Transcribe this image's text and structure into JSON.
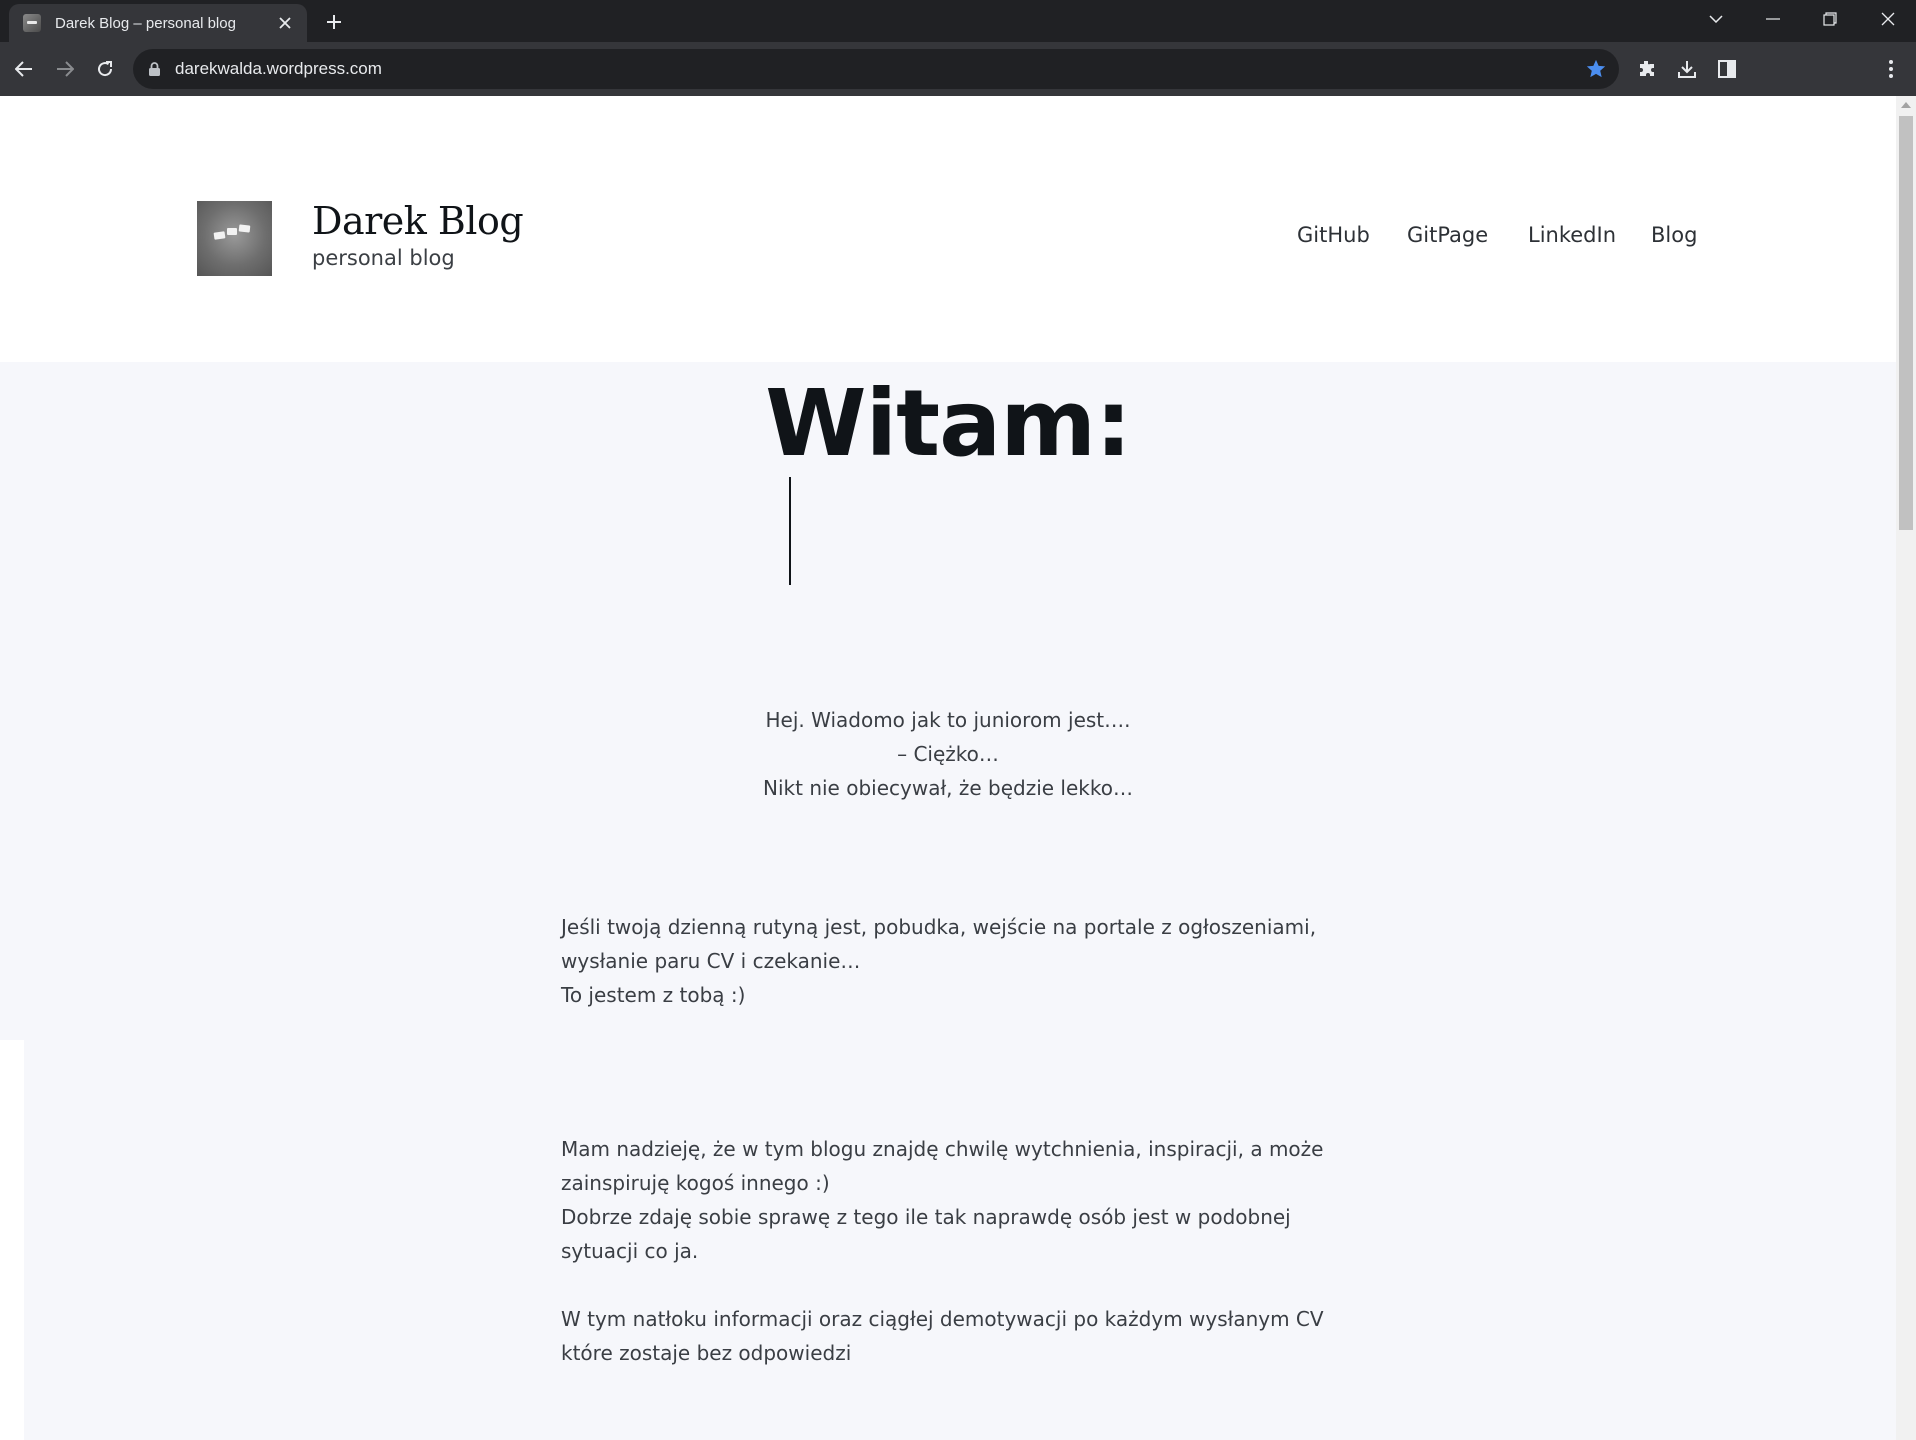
{
  "browser": {
    "tab_title": "Darek Blog – personal blog",
    "url": "darekwalda.wordpress.com"
  },
  "site": {
    "title": "Darek Blog",
    "description": "personal blog",
    "nav": [
      "GitHub",
      "GitPage",
      "LinkedIn",
      "Blog"
    ]
  },
  "post": {
    "heading": "Witam:",
    "intro": [
      "Hej. Wiadomo jak to juniorom jest….",
      "– Ciężko…",
      "Nikt nie obiecywał, że będzie lekko…"
    ],
    "paragraph1": [
      "Jeśli twoją dzienną rutyną jest, pobudka, wejście na portale z ogłoszeniami,",
      "wysłanie paru CV i czekanie…",
      "To jestem z tobą :)"
    ],
    "paragraph2": [
      "Mam nadzieję, że w tym blogu znajdę chwilę wytchnienia, inspiracji, a może",
      "zainspiruję kogoś innego :)",
      "Dobrze zdaję sobie sprawę z tego ile tak naprawdę osób jest w podobnej",
      "sytuacji co ja."
    ],
    "paragraph3": [
      "W tym natłoku informacji oraz ciągłej demotywacji po każdym wysłanym CV",
      "które zostaje bez odpowiedzi"
    ]
  },
  "colors": {
    "chrome_dark": "#202124",
    "chrome_toolbar": "#35363a",
    "bookmark_star": "#8ab4f8",
    "page_bg": "#f6f7fb",
    "text": "#101418"
  }
}
